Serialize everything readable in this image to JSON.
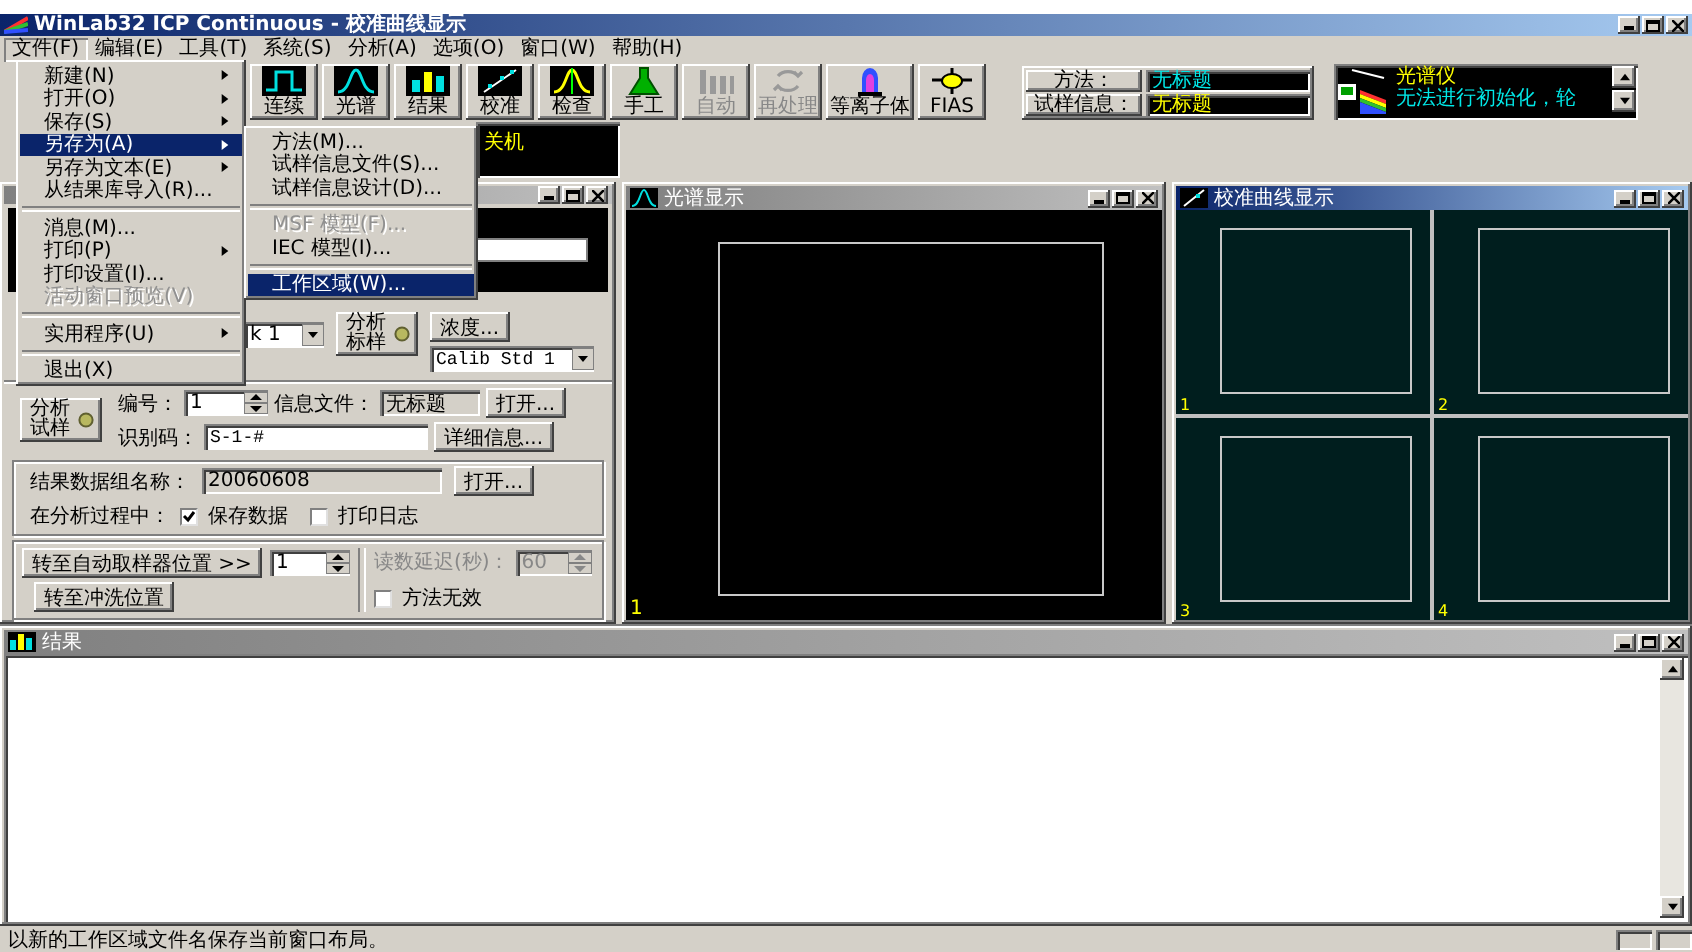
{
  "window": {
    "title": "WinLab32 ICP Continuous - 校准曲线显示",
    "active": true
  },
  "menu_bar": [
    {
      "label": "文件(F)",
      "selected": true
    },
    {
      "label": "编辑(E)",
      "selected": false
    },
    {
      "label": "工具(T)",
      "selected": false
    },
    {
      "label": "系统(S)",
      "selected": false
    },
    {
      "label": "分析(A)",
      "selected": false
    },
    {
      "label": "选项(O)",
      "selected": false
    },
    {
      "label": "窗口(W)",
      "selected": false
    },
    {
      "label": "帮助(H)",
      "selected": false
    }
  ],
  "file_menu": {
    "items": [
      {
        "kind": "item",
        "label": "新建(N)",
        "submenu": true,
        "disabled": false,
        "selected": false
      },
      {
        "kind": "item",
        "label": "打开(O)",
        "submenu": true,
        "disabled": false,
        "selected": false
      },
      {
        "kind": "item",
        "label": "保存(S)",
        "submenu": true,
        "disabled": false,
        "selected": false
      },
      {
        "kind": "item",
        "label": "另存为(A)",
        "submenu": true,
        "disabled": false,
        "selected": true
      },
      {
        "kind": "item",
        "label": "另存为文本(E)",
        "submenu": true,
        "disabled": false,
        "selected": false
      },
      {
        "kind": "item",
        "label": "从结果库导入(R)...",
        "submenu": false,
        "disabled": false,
        "selected": false
      },
      {
        "kind": "separator"
      },
      {
        "kind": "item",
        "label": "消息(M)...",
        "submenu": false,
        "disabled": false,
        "selected": false
      },
      {
        "kind": "item",
        "label": "打印(P)",
        "submenu": true,
        "disabled": false,
        "selected": false
      },
      {
        "kind": "item",
        "label": "打印设置(I)...",
        "submenu": false,
        "disabled": false,
        "selected": false
      },
      {
        "kind": "item",
        "label": "活动窗口预览(V)",
        "submenu": false,
        "disabled": true,
        "selected": false
      },
      {
        "kind": "separator"
      },
      {
        "kind": "item",
        "label": "实用程序(U)",
        "submenu": true,
        "disabled": false,
        "selected": false
      },
      {
        "kind": "separator"
      },
      {
        "kind": "item",
        "label": "退出(X)",
        "submenu": false,
        "disabled": false,
        "selected": false
      }
    ]
  },
  "save_as_submenu": {
    "items": [
      {
        "kind": "item",
        "label": "方法(M)...",
        "disabled": false,
        "selected": false
      },
      {
        "kind": "item",
        "label": "试样信息文件(S)...",
        "disabled": false,
        "selected": false
      },
      {
        "kind": "item",
        "label": "试样信息设计(D)...",
        "disabled": false,
        "selected": false
      },
      {
        "kind": "separator"
      },
      {
        "kind": "item",
        "label": "MSF 模型(F)...",
        "disabled": true,
        "selected": false
      },
      {
        "kind": "item",
        "label": "IEC 模型(I)...",
        "disabled": false,
        "selected": false
      },
      {
        "kind": "separator"
      },
      {
        "kind": "item",
        "label": "工作区域(W)...",
        "disabled": false,
        "selected": true
      }
    ]
  },
  "toolbar": {
    "buttons": [
      {
        "kind": "continuous",
        "label": "连续",
        "disabled": false
      },
      {
        "kind": "spectrum",
        "label": "光谱",
        "disabled": false
      },
      {
        "kind": "results",
        "label": "结果",
        "disabled": false
      },
      {
        "kind": "calibrate",
        "label": "校准",
        "disabled": false
      },
      {
        "kind": "check",
        "label": "检查",
        "disabled": false
      },
      {
        "kind": "manual",
        "label": "手工",
        "disabled": false
      },
      {
        "kind": "auto",
        "label": "自动",
        "disabled": true
      },
      {
        "kind": "reprocess",
        "label": "再处理",
        "disabled": true
      },
      {
        "kind": "plasma",
        "label": "等离子体",
        "disabled": false
      },
      {
        "kind": "fias",
        "label": "FIAS",
        "disabled": false
      }
    ]
  },
  "method_info": {
    "method_label": "方法：",
    "method_value": "无标题",
    "sample_label": "试样信息：",
    "sample_value": "无标题"
  },
  "instrument_status": {
    "title": "光谱仪",
    "message": "无法进行初始化，轮"
  },
  "status_box": {
    "text": "关机"
  },
  "manual_panel": {
    "sample_select": "k 1",
    "analyze_standard": "分析标样",
    "concentration_button": "浓度...",
    "standard_select": "Calib Std 1",
    "analyze_sample": "分析试样",
    "number_label": "编号：",
    "number_value": "1",
    "info_file_label": "信息文件：",
    "info_file_value": "无标题",
    "info_open": "打开...",
    "id_label": "识别码：",
    "id_value": "S-1-#",
    "details_button": "详细信息...",
    "result_set_label": "结果数据组名称：",
    "result_set_value": "20060608",
    "result_open": "打开...",
    "during_label": "在分析过程中：",
    "options": [
      {
        "label": "保存数据",
        "checked": true
      },
      {
        "label": "打印日志",
        "checked": false
      }
    ],
    "autosampler_button": "转至自动取样器位置 >>",
    "autosampler_value": "1",
    "delay_label": "读数延迟(秒)：",
    "delay_value": "60",
    "delay_disabled": true,
    "rinse_button": "转至冲洗位置",
    "invalid_method": {
      "label": "方法无效",
      "checked": false
    }
  },
  "spectrum_window": {
    "title": "光谱显示",
    "active": false,
    "plot_label": "1"
  },
  "calibration_window": {
    "title": "校准曲线显示",
    "active": true,
    "plots": [
      {
        "label": "1"
      },
      {
        "label": "2"
      },
      {
        "label": "3"
      },
      {
        "label": "4"
      }
    ]
  },
  "results_window": {
    "title": "结果",
    "active": false
  },
  "status_bar": {
    "text": "以新的工作区域文件名保存当前窗口布局。"
  }
}
